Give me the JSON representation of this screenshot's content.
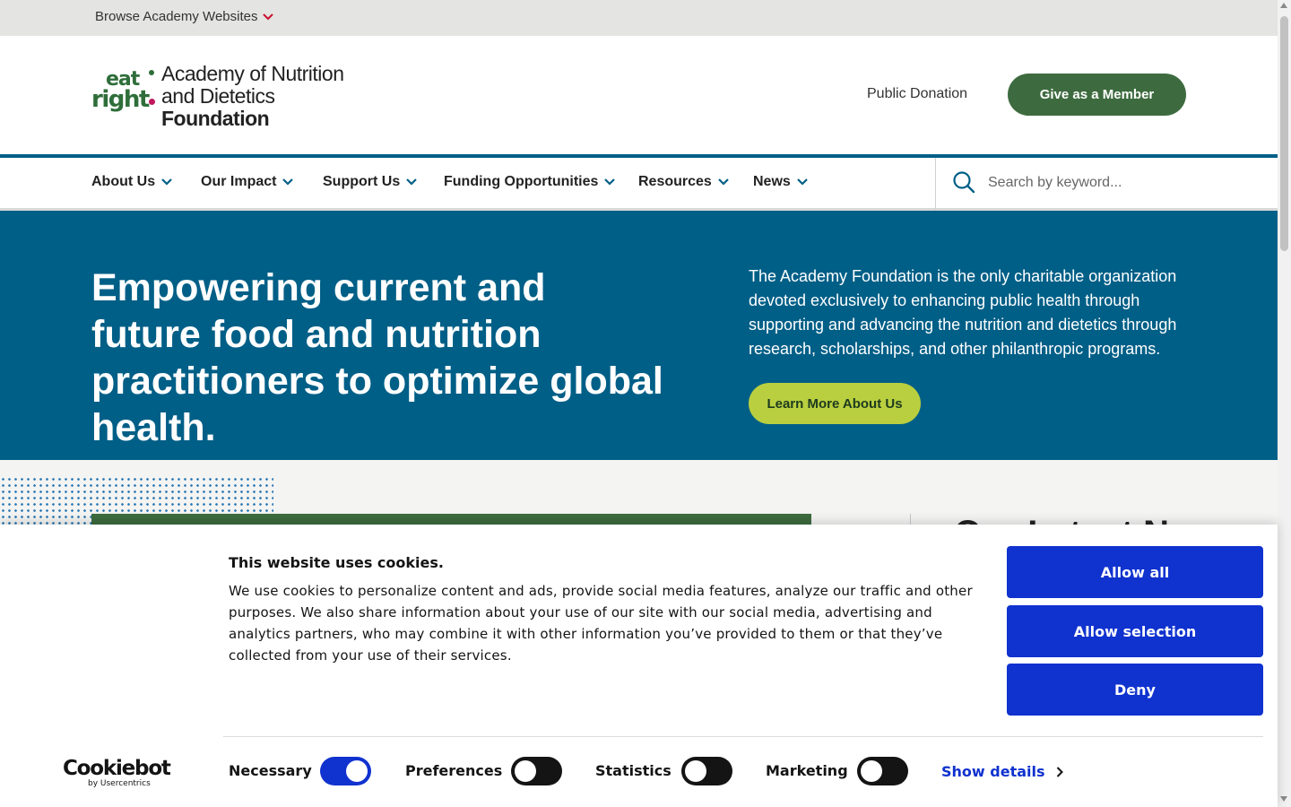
{
  "utility_bar": {
    "browse_label": "Browse Academy Websites"
  },
  "header": {
    "logo": {
      "mark_top": "eat",
      "mark_bottom": "right",
      "org_line1": "Academy of Nutrition",
      "org_line2": "and Dietetics",
      "org_line3": "Foundation"
    },
    "public_donation": "Public Donation",
    "give_button": "Give as a Member"
  },
  "nav": {
    "items": [
      {
        "label": "About Us"
      },
      {
        "label": "Our Impact"
      },
      {
        "label": "Support Us"
      },
      {
        "label": "Funding Opportunities"
      },
      {
        "label": "Resources"
      },
      {
        "label": "News"
      }
    ],
    "search": {
      "placeholder": "Search by keyword...",
      "icon": "search-icon"
    }
  },
  "hero": {
    "heading": "Empowering current and future food and nutrition practitioners to optimize global health.",
    "description": "The Academy Foundation is the only charitable organization devoted exclusively to enhancing public health through supporting and advancing the nutrition and dietetics through research, scholarships, and other philanthropic programs.",
    "cta": "Learn More About Us"
  },
  "lower": {
    "latest_heading": "Our Latest N"
  },
  "cookie_banner": {
    "title": "This website uses cookies.",
    "body": "We use cookies to personalize content and ads, provide social media features, analyze our traffic and other purposes. We also share information about your use of our site with our social media, advertising and analytics partners, who may combine it with other information you’ve provided to them or that they’ve collected from your use of their services.",
    "buttons": {
      "allow_all": "Allow all",
      "allow_selection": "Allow selection",
      "deny": "Deny"
    },
    "toggles": [
      {
        "label": "Necessary",
        "on": true
      },
      {
        "label": "Preferences",
        "on": false
      },
      {
        "label": "Statistics",
        "on": false
      },
      {
        "label": "Marketing",
        "on": false
      }
    ],
    "show_details": "Show details",
    "brand": {
      "name": "Cookiebot",
      "sub": "by Usercentrics"
    }
  },
  "colors": {
    "primary_blue": "#005f87",
    "green": "#3d6b3f",
    "lime": "#b9cf3f",
    "cookie_blue": "#1032cf"
  }
}
